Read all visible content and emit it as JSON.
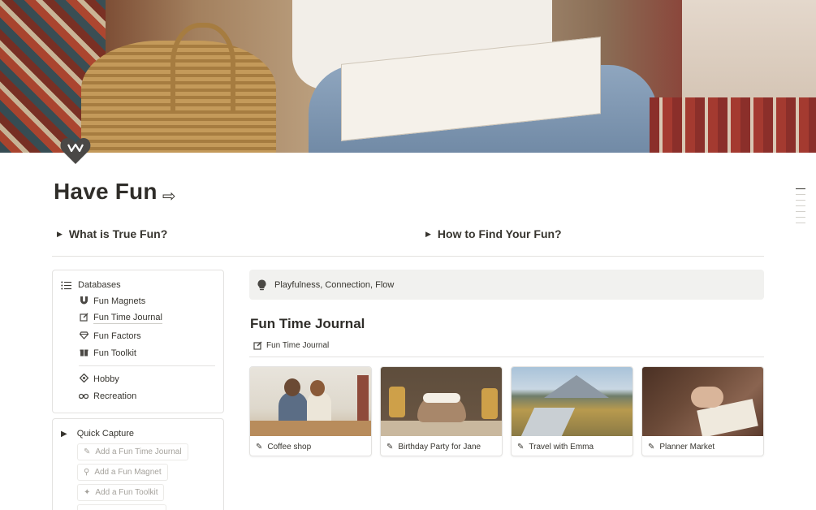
{
  "page": {
    "title": "Have Fun",
    "title_arrow": "⇨"
  },
  "toggles": [
    {
      "label": "What is True Fun?"
    },
    {
      "label": "How to Find Your Fun?"
    }
  ],
  "databases": {
    "header": "Databases",
    "items": [
      {
        "label": "Fun Magnets",
        "icon": "magnet-icon"
      },
      {
        "label": "Fun Time Journal",
        "icon": "edit-icon"
      },
      {
        "label": "Fun Factors",
        "icon": "gem-icon"
      },
      {
        "label": "Fun Toolkit",
        "icon": "gift-icon"
      },
      {
        "label": "Hobby",
        "icon": "hobby-icon"
      },
      {
        "label": "Recreation",
        "icon": "binoculars-icon"
      }
    ]
  },
  "quick_capture": {
    "header": "Quick Capture",
    "buttons": [
      {
        "label": "Add a Fun Time Journal",
        "icon": "pen-icon"
      },
      {
        "label": "Add a Fun Magnet",
        "icon": "magnet-icon"
      },
      {
        "label": "Add a Fun Toolkit",
        "icon": "party-icon"
      }
    ]
  },
  "callout": {
    "text": "Playfulness, Connection, Flow",
    "icon": "lightbulb-icon"
  },
  "journal": {
    "heading": "Fun Time Journal",
    "view_label": "Fun Time Journal",
    "cards": [
      {
        "title": "Coffee shop"
      },
      {
        "title": "Birthday Party for Jane"
      },
      {
        "title": "Travel with Emma"
      },
      {
        "title": "Planner Market"
      }
    ]
  }
}
